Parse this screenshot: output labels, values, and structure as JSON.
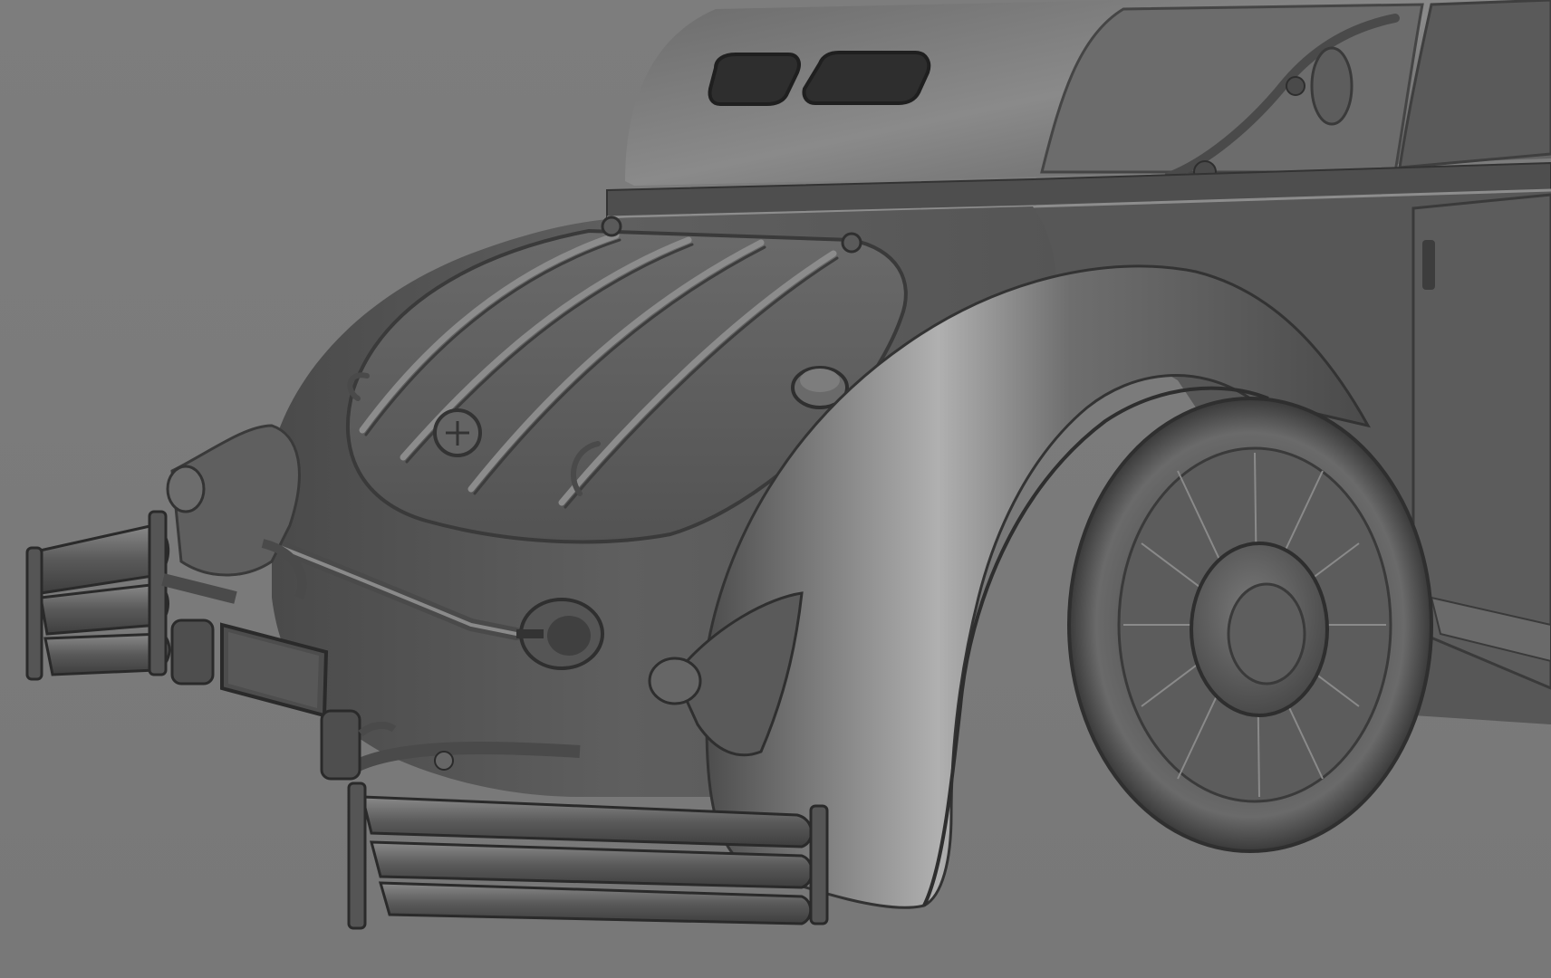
{
  "scene": {
    "subject": "vintage-car-rear-3d-model",
    "render_style": "grey-clay-viewport",
    "colors": {
      "background": "#7b7b7b",
      "body_base": "#5e5e5e",
      "body_dark": "#3f3f3f",
      "body_light": "#a8a8a8",
      "outline": "#2c2c2c"
    }
  }
}
